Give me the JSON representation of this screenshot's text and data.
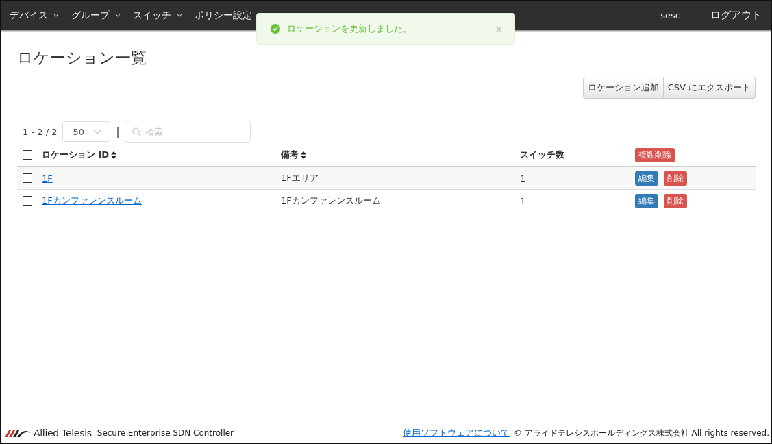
{
  "nav": {
    "items": [
      {
        "label": "デバイス",
        "dropdown": true
      },
      {
        "label": "グループ",
        "dropdown": true
      },
      {
        "label": "スイッチ",
        "dropdown": true
      },
      {
        "label": "ポリシー設定",
        "dropdown": false
      }
    ],
    "user": "sesc",
    "logout": "ログアウト"
  },
  "toast": {
    "message": "ロケーションを更新しました。",
    "close": "×"
  },
  "page_title": "ロケーション一覧",
  "actions": [
    "ロケーション追加",
    "CSV にエクスポート"
  ],
  "pager": {
    "range": "1 - 2 / 2",
    "page_size": "50",
    "separator": "|",
    "search_placeholder": "検索"
  },
  "table": {
    "select_all_checked": false,
    "columns": [
      {
        "label": "ロケーション ID",
        "sortable": true
      },
      {
        "label": "備考",
        "sortable": true
      },
      {
        "label": "スイッチ数",
        "sortable": false
      }
    ],
    "bulk_delete": "複数削除",
    "rows": [
      {
        "checked": false,
        "id": "1F",
        "note": "1Fエリア",
        "switches": "1",
        "edit": "編集",
        "delete": "削除"
      },
      {
        "checked": false,
        "id": "1Fカンファレンスルーム",
        "note": "1Fカンファレンスルーム",
        "switches": "1",
        "edit": "編集",
        "delete": "削除"
      }
    ]
  },
  "footer": {
    "logo": "Allied Telesis",
    "product": "Secure Enterprise SDN Controller",
    "link": "使用ソフトウェアについて",
    "copyright": "© アライドテレシスホールディングス株式会社 All rights reserved."
  }
}
